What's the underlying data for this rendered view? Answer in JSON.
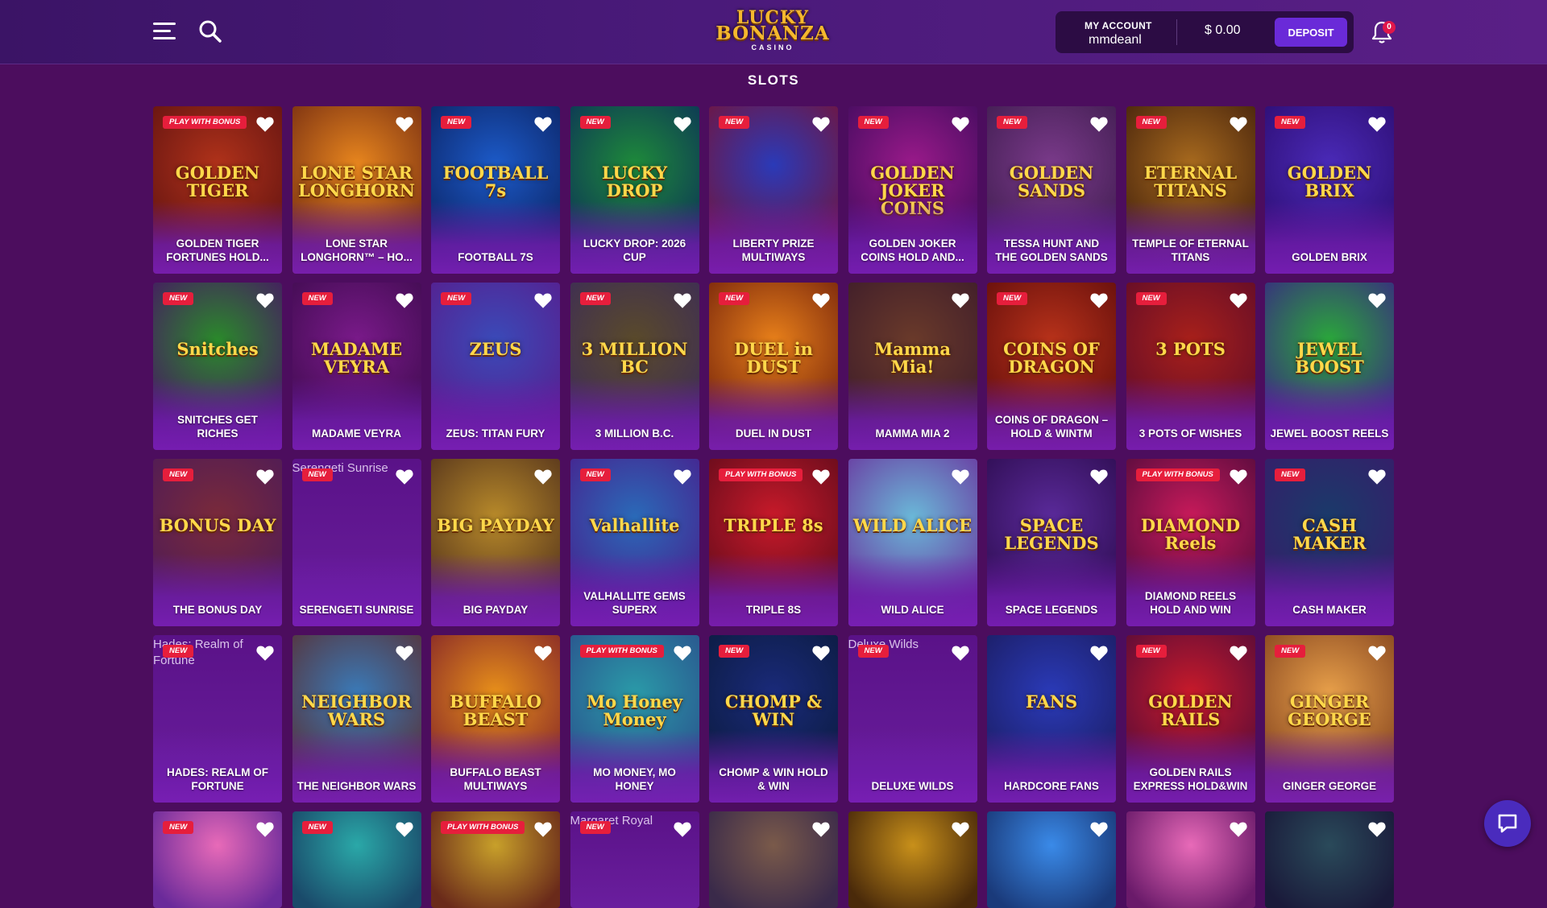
{
  "header": {
    "logo_line1": "LUCKY",
    "logo_line2": "BONANZA",
    "logo_line3": "CASINO",
    "account_label": "MY ACCOUNT",
    "username": "mmdeanl",
    "balance": "$ 0.00",
    "deposit_label": "DEPOSIT",
    "notification_count": "0"
  },
  "section_title": "SLOTS",
  "colors": {
    "background": "#4c0d5e",
    "header": "#4a1a7a",
    "deposit": "#6a2ad8",
    "tag": "#e61e3c"
  },
  "games": [
    {
      "name": "GOLDEN TIGER FORTUNES HOLD...",
      "tag": "PLAY WITH BONUS",
      "art": "GOLDEN TIGER",
      "bg": [
        "#b0321a",
        "#5a1010"
      ]
    },
    {
      "name": "LONE STAR LONGHORN™ – HO...",
      "tag": "",
      "art": "LONE STAR LONGHORN",
      "bg": [
        "#e8861e",
        "#6a2410"
      ]
    },
    {
      "name": "FOOTBALL 7S",
      "tag": "NEW",
      "art": "FOOTBALL 7s",
      "bg": [
        "#1c5ac8",
        "#0a1e5a"
      ]
    },
    {
      "name": "LUCKY DROP: 2026 CUP",
      "tag": "NEW",
      "art": "LUCKY DROP",
      "bg": [
        "#1e8a3a",
        "#0a2a5a"
      ]
    },
    {
      "name": "LIBERTY PRIZE MULTIWAYS",
      "tag": "NEW",
      "art": "",
      "bg": [
        "#2a3ab8",
        "#7a1030"
      ]
    },
    {
      "name": "GOLDEN JOKER COINS HOLD AND...",
      "tag": "NEW",
      "art": "GOLDEN JOKER COINS",
      "bg": [
        "#9a1a8a",
        "#3a0a5a"
      ]
    },
    {
      "name": "TESSA HUNT AND THE GOLDEN SANDS",
      "tag": "NEW",
      "art": "GOLDEN SANDS",
      "bg": [
        "#7a3a8a",
        "#3a1a4a"
      ]
    },
    {
      "name": "TEMPLE OF ETERNAL TITANS",
      "tag": "NEW",
      "art": "ETERNAL TITANS",
      "bg": [
        "#a86a1e",
        "#3a1a0a"
      ]
    },
    {
      "name": "GOLDEN BRIX",
      "tag": "NEW",
      "art": "GOLDEN BRIX",
      "bg": [
        "#4a2ab8",
        "#2a0a6a"
      ]
    },
    {
      "name": "SNITCHES GET RICHES",
      "tag": "NEW",
      "art": "Snitches",
      "bg": [
        "#2a8a2a",
        "#4a0a6a"
      ]
    },
    {
      "name": "MADAME VEYRA",
      "tag": "NEW",
      "art": "MADAME VEYRA",
      "bg": [
        "#7a1a8a",
        "#3a0a4a"
      ]
    },
    {
      "name": "ZEUS: TITAN FURY",
      "tag": "NEW",
      "art": "ZEUS",
      "bg": [
        "#3a4ab8",
        "#5a1a8a"
      ]
    },
    {
      "name": "3 MILLION B.C.",
      "tag": "NEW",
      "art": "3 MILLION BC",
      "bg": [
        "#5a4a2a",
        "#3a2a5a"
      ]
    },
    {
      "name": "DUEL IN DUST",
      "tag": "NEW",
      "art": "DUEL in DUST",
      "bg": [
        "#e8801a",
        "#6a1a0a"
      ]
    },
    {
      "name": "MAMMA MIA 2",
      "tag": "",
      "art": "Mamma Mia!",
      "bg": [
        "#6a3a2a",
        "#3a1a2a"
      ]
    },
    {
      "name": "COINS OF DRAGON – HOLD & WINTM",
      "tag": "NEW",
      "art": "COINS OF DRAGON",
      "bg": [
        "#b8321a",
        "#5a0a0a"
      ]
    },
    {
      "name": "3 POTS OF WISHES",
      "tag": "NEW",
      "art": "3 POTS",
      "bg": [
        "#a8201a",
        "#5a0a2a"
      ]
    },
    {
      "name": "JEWEL BOOST REELS",
      "tag": "",
      "art": "JEWEL BOOST",
      "bg": [
        "#2aa83a",
        "#3a1a8a"
      ]
    },
    {
      "name": "THE BONUS DAY",
      "tag": "NEW",
      "art": "BONUS DAY",
      "bg": [
        "#7a2a3a",
        "#4a1a5a"
      ]
    },
    {
      "name": "SERENGETI SUNRISE",
      "tag": "NEW",
      "art": "",
      "bg": [],
      "broken": true,
      "alt": "Serengeti Sunrise"
    },
    {
      "name": "BIG PAYDAY",
      "tag": "",
      "art": "BIG PAYDAY",
      "bg": [
        "#b88a2a",
        "#4a2a1a"
      ]
    },
    {
      "name": "VALHALLITE GEMS SUPERX",
      "tag": "NEW",
      "art": "Valhallite",
      "bg": [
        "#2a6ab8",
        "#4a1a8a"
      ]
    },
    {
      "name": "TRIPLE 8S",
      "tag": "PLAY WITH BONUS",
      "art": "TRIPLE 8s",
      "bg": [
        "#c81a2a",
        "#5a0a1a"
      ]
    },
    {
      "name": "WILD ALICE",
      "tag": "",
      "art": "WILD ALICE",
      "bg": [
        "#6ab8d8",
        "#6a2a9a"
      ]
    },
    {
      "name": "SPACE LEGENDS",
      "tag": "",
      "art": "SPACE LEGENDS",
      "bg": [
        "#5a2a9a",
        "#2a0a4a"
      ]
    },
    {
      "name": "DIAMOND REELS HOLD AND WIN",
      "tag": "PLAY WITH BONUS",
      "art": "DIAMOND Reels",
      "bg": [
        "#c81a5a",
        "#4a0a3a"
      ]
    },
    {
      "name": "CASH MAKER",
      "tag": "NEW",
      "art": "CASH MAKER",
      "bg": [
        "#1a3a6a",
        "#3a1a6a"
      ]
    },
    {
      "name": "HADES: REALM OF FORTUNE",
      "tag": "NEW",
      "art": "",
      "bg": [],
      "broken": true,
      "alt": "Hades: Realm of Fortune"
    },
    {
      "name": "THE NEIGHBOR WARS",
      "tag": "",
      "art": "NEIGHBOR WARS",
      "bg": [
        "#3a7ab8",
        "#5a2a2a"
      ]
    },
    {
      "name": "BUFFALO BEAST MULTIWAYS",
      "tag": "",
      "art": "BUFFALO BEAST",
      "bg": [
        "#e8901a",
        "#7a1a2a"
      ]
    },
    {
      "name": "MO MONEY, MO HONEY",
      "tag": "PLAY WITH BONUS",
      "art": "Mo Honey Money",
      "bg": [
        "#2a9aa8",
        "#2a4a8a"
      ]
    },
    {
      "name": "CHOMP & WIN HOLD & WIN",
      "tag": "NEW",
      "art": "CHOMP & WIN",
      "bg": [
        "#1a2a7a",
        "#0a1a3a"
      ]
    },
    {
      "name": "DELUXE WILDS",
      "tag": "NEW",
      "art": "",
      "bg": [],
      "broken": true,
      "alt": "Deluxe Wilds"
    },
    {
      "name": "HARDCORE FANS",
      "tag": "",
      "art": "FANS",
      "bg": [
        "#2a3ab8",
        "#1a1a5a"
      ]
    },
    {
      "name": "GOLDEN RAILS EXPRESS HOLD&WIN",
      "tag": "NEW",
      "art": "GOLDEN RAILS",
      "bg": [
        "#c81a2a",
        "#4a0a3a"
      ]
    },
    {
      "name": "GINGER GEORGE",
      "tag": "NEW",
      "art": "GINGER GEORGE",
      "bg": [
        "#e8a04a",
        "#7a3a1a"
      ]
    },
    {
      "name": "",
      "tag": "NEW",
      "art": "",
      "bg": [
        "#e86ab8",
        "#6a2a9a"
      ],
      "partial": true
    },
    {
      "name": "",
      "tag": "NEW",
      "art": "",
      "bg": [
        "#2aa8a8",
        "#1a4a6a"
      ],
      "partial": true
    },
    {
      "name": "",
      "tag": "PLAY WITH BONUS",
      "art": "",
      "bg": [
        "#c8a02a",
        "#6a2a1a"
      ],
      "partial": true
    },
    {
      "name": "",
      "tag": "NEW",
      "art": "",
      "bg": [],
      "broken": true,
      "partial": true,
      "alt": "Margaret Royal"
    },
    {
      "name": "",
      "tag": "",
      "art": "",
      "bg": [
        "#7a5a4a",
        "#3a2a4a"
      ],
      "partial": true
    },
    {
      "name": "",
      "tag": "",
      "art": "",
      "bg": [
        "#c8901a",
        "#4a2a0a"
      ],
      "partial": true
    },
    {
      "name": "",
      "tag": "",
      "art": "",
      "bg": [
        "#3a8ae8",
        "#1a3a7a"
      ],
      "partial": true
    },
    {
      "name": "",
      "tag": "",
      "art": "",
      "bg": [
        "#e86ab8",
        "#6a1a6a"
      ],
      "partial": true
    },
    {
      "name": "",
      "tag": "",
      "art": "",
      "bg": [
        "#2a4a5a",
        "#1a1a3a"
      ],
      "partial": true
    }
  ]
}
